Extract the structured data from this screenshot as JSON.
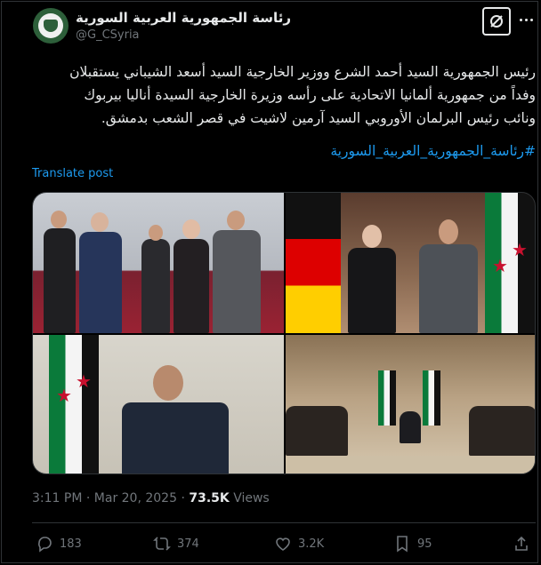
{
  "account": {
    "name": "رئاسة الجمهورية العربية السورية",
    "handle": "@G_CSyria"
  },
  "post": {
    "lines": [
      "رئيس الجمهورية السيد أحمد الشرع ووزير الخارجية السيد أسعد الشيباني يستقبلان",
      "وفداً من جمهورية ألمانيا الاتحادية على رأسه وزيرة الخارجية السيدة أناليا بيربوك",
      "ونائب رئيس البرلمان الأوروبي السيد آرمين لاشيت في قصر الشعب بدمشق."
    ],
    "hashtag": "#رئاسة_الجمهورية_العربية_السورية",
    "translate_label": "Translate post"
  },
  "meta": {
    "time": "3:11 PM",
    "separator": "·",
    "date": "Mar 20, 2025",
    "views_count": "73.5K",
    "views_label": "Views"
  },
  "actions": {
    "replies": "183",
    "reposts": "374",
    "likes": "3.2K",
    "bookmarks": "95"
  },
  "icons": [
    "grok-icon",
    "more-icon",
    "reply-icon",
    "repost-icon",
    "like-icon",
    "bookmark-icon",
    "share-icon"
  ],
  "colors": {
    "accent": "#1d9bf0",
    "muted": "#71767b",
    "text": "#e7e9ea",
    "background": "#000000"
  }
}
